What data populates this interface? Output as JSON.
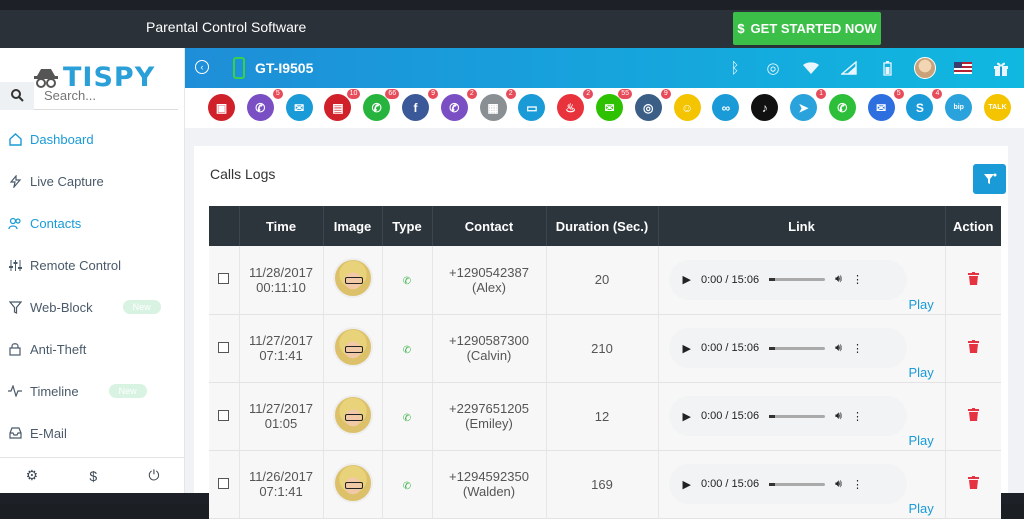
{
  "topbar": {
    "title": "Parental Control Software",
    "cta_label": "GET STARTED NOW",
    "cta_icon": "$"
  },
  "sidebar": {
    "logo_text": "TISPY",
    "search_placeholder": "Search...",
    "items": [
      {
        "label": "Dashboard",
        "icon": "home-icon"
      },
      {
        "label": "Live Capture",
        "icon": "bolt-icon"
      },
      {
        "label": "Contacts",
        "icon": "users-icon"
      },
      {
        "label": "Remote Control",
        "icon": "sliders-icon"
      },
      {
        "label": "Web-Block",
        "icon": "filter-icon",
        "badge": "New"
      },
      {
        "label": "Anti-Theft",
        "icon": "lock-icon"
      },
      {
        "label": "Timeline",
        "icon": "activity-icon",
        "badge": "New"
      },
      {
        "label": "E-Mail",
        "icon": "inbox-icon"
      }
    ],
    "footer": {
      "settings": "⚙",
      "dollar": "$",
      "power": "⏻"
    }
  },
  "device": {
    "model": "GT-I9505"
  },
  "apps": [
    {
      "name": "screen-recorder",
      "color": "#d0202a",
      "count": ""
    },
    {
      "name": "viber",
      "color": "#7b4fc4",
      "count": "5"
    },
    {
      "name": "mail",
      "color": "#1a9bd7",
      "count": ""
    },
    {
      "name": "gallery",
      "color": "#d0202a",
      "count": "10"
    },
    {
      "name": "whatsapp",
      "color": "#27b43e",
      "count": "66"
    },
    {
      "name": "facebook",
      "color": "#3b5998",
      "count": "9"
    },
    {
      "name": "viber-2",
      "color": "#7b4fc4",
      "count": "2"
    },
    {
      "name": "files",
      "color": "#8a8f94",
      "count": "2"
    },
    {
      "name": "desktop",
      "color": "#1a9bd7",
      "count": ""
    },
    {
      "name": "tinder",
      "color": "#e8333c",
      "count": "2"
    },
    {
      "name": "wechat",
      "color": "#2dc100",
      "count": "55"
    },
    {
      "name": "instagram",
      "color": "#3a5e86",
      "count": "9"
    },
    {
      "name": "snapchat",
      "color": "#f5c400",
      "count": ""
    },
    {
      "name": "hike",
      "color": "#1a9bd7",
      "count": ""
    },
    {
      "name": "tiktok",
      "color": "#111111",
      "count": ""
    },
    {
      "name": "telegram",
      "color": "#2aa3dc",
      "count": "1"
    },
    {
      "name": "line",
      "color": "#2dbe3a",
      "count": ""
    },
    {
      "name": "messenger",
      "color": "#2e6fe0",
      "count": "5"
    },
    {
      "name": "skype",
      "color": "#1a9bd7",
      "count": "4"
    },
    {
      "name": "bip",
      "color": "#2aa3dc",
      "count": ""
    },
    {
      "name": "talk",
      "color": "#f5c400",
      "count": ""
    }
  ],
  "page": {
    "title": "Calls Logs"
  },
  "table": {
    "headers": [
      "",
      "Time",
      "Image",
      "Type",
      "Contact",
      "Duration (Sec.)",
      "Link",
      "Action"
    ],
    "rows": [
      {
        "date": "11/28/2017",
        "time": "00:11:10",
        "number": "+1290542387",
        "name": "(Alex)",
        "duration": "20",
        "player": "0:00 / 15:06",
        "progress": 0,
        "link": "Play"
      },
      {
        "date": "11/27/2017",
        "time": "07:1:41",
        "number": "+1290587300",
        "name": "(Calvin)",
        "duration": "210",
        "player": "0:00 / 15:06",
        "progress": 0,
        "link": "Play"
      },
      {
        "date": "11/27/2017",
        "time": "01:05",
        "number": "+2297651205",
        "name": "(Emiley)",
        "duration": "12",
        "player": "0:00 / 15:06",
        "progress": 0.1,
        "link": "Play"
      },
      {
        "date": "11/26/2017",
        "time": "07:1:41",
        "number": "+1294592350",
        "name": "(Walden)",
        "duration": "169",
        "player": "0:00 / 15:06",
        "progress": 0.1,
        "link": "Play"
      }
    ]
  }
}
